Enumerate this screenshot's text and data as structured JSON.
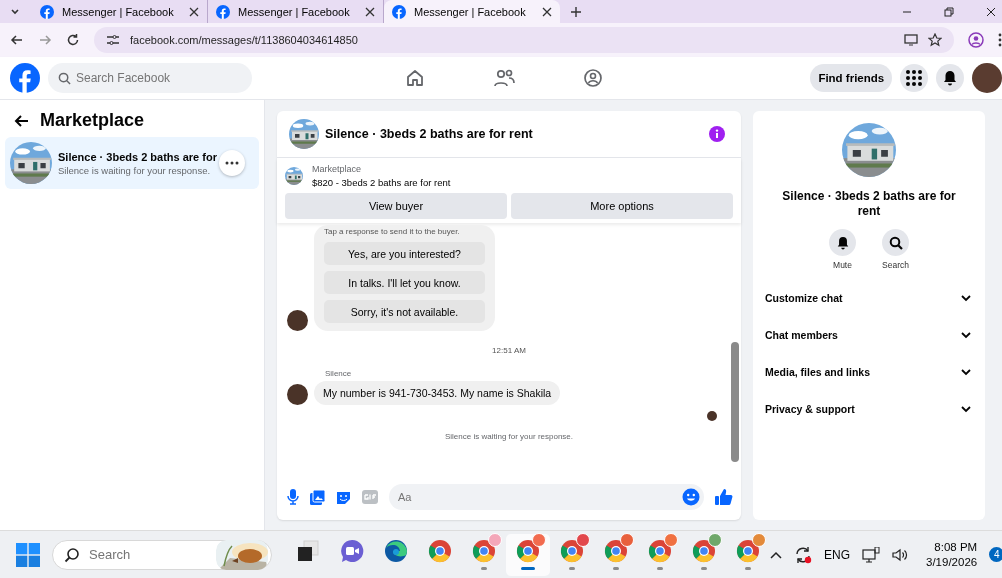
{
  "browser": {
    "tabs": [
      {
        "title": "Messenger | Facebook",
        "selected": false
      },
      {
        "title": "Messenger | Facebook",
        "selected": false
      },
      {
        "title": "Messenger | Facebook",
        "selected": true
      }
    ],
    "url": "facebook.com/messages/t/1138604034614850"
  },
  "header": {
    "search": {
      "placeholder": "Search Facebook"
    },
    "find_friends": "Find friends"
  },
  "sidebar": {
    "title": "Marketplace",
    "conversations": [
      {
        "title": "Silence · 3beds 2 baths are for",
        "subtitle": "Silence is waiting for your response.",
        "selected": true
      }
    ]
  },
  "chat": {
    "title": "Silence · 3beds 2 baths are for rent",
    "listing": {
      "label": "Marketplace",
      "text": "$820 - 3beds 2 baths are for rent"
    },
    "buttons": [
      "View buyer",
      "More options"
    ],
    "hint": "Tap a response to send it to the buyer.",
    "quick_replies": [
      "Yes, are you interested?",
      "In talks. I'll let you know.",
      "Sorry, it's not available."
    ],
    "timestamp": "12:51 AM",
    "sender": "Silence",
    "message": "My number is 941-730-3453. My name is Shakila",
    "status": "Silence is waiting for your response.",
    "composer": {
      "placeholder": "Aa"
    }
  },
  "details": {
    "title": "Silence · 3beds 2 baths are for rent",
    "actions": [
      {
        "kind": "mute",
        "label": "Mute"
      },
      {
        "kind": "search",
        "label": "Search"
      }
    ],
    "sections": [
      {
        "label": "Customize chat",
        "expanded": false
      },
      {
        "label": "Chat members",
        "expanded": false
      },
      {
        "label": "Media, files and links",
        "expanded": false
      },
      {
        "label": "Privacy & support",
        "expanded": false
      }
    ]
  },
  "taskbar": {
    "search": {
      "placeholder": "Search"
    },
    "apps": [
      {
        "kind": "taskview",
        "running": false,
        "selected": false
      },
      {
        "kind": "meet",
        "running": false,
        "selected": false
      },
      {
        "kind": "edge",
        "running": false,
        "selected": false
      },
      {
        "kind": "chrome",
        "running": false,
        "selected": false
      },
      {
        "kind": "chrome",
        "running": true,
        "selected": false,
        "color": "#f4a7b9"
      },
      {
        "kind": "chrome",
        "running": true,
        "selected": true,
        "color": "#f26b4f"
      },
      {
        "kind": "chrome",
        "running": true,
        "selected": false,
        "color": "#e2474b"
      },
      {
        "kind": "chrome",
        "running": true,
        "selected": false,
        "color": "#e8603c"
      },
      {
        "kind": "chrome",
        "running": true,
        "selected": false,
        "color": "#f07040"
      },
      {
        "kind": "chrome",
        "running": true,
        "selected": false,
        "color": "#6fa86a"
      },
      {
        "kind": "chrome",
        "running": true,
        "selected": false,
        "color": "#e38a3a"
      }
    ],
    "language": "ENG",
    "time": "8:08 PM",
    "date": "3/19/2026",
    "notifications": "4"
  }
}
